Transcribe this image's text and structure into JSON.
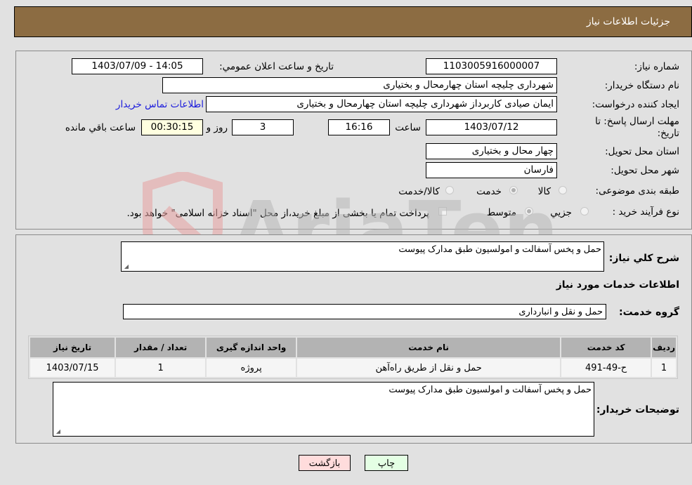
{
  "header": {
    "title": "جزئیات اطلاعات نیاز"
  },
  "fields": {
    "need_number_label": "شماره نیاز:",
    "need_number": "1103005916000007",
    "announce_label": "تاریخ و ساعت اعلان عمومي:",
    "announce_value": "1403/07/09 - 14:05",
    "buyer_org_label": "نام دستگاه خریدار:",
    "buyer_org": "شهرداری چلیچه استان چهارمحال و بختیاری",
    "creator_label": "ایجاد کننده درخواست:",
    "creator": "ایمان صیادی کاربرداز شهرداری چلیچه استان چهارمحال و بختیاری",
    "contact_link": "اطلاعات تماس خریدار",
    "deadline_label": "مهلت ارسال پاسخ: تا تاریخ:",
    "deadline_date": "1403/07/12",
    "time_label": "ساعت",
    "deadline_time": "16:16",
    "days_value": "3",
    "days_label": "روز و",
    "remaining_time": "00:30:15",
    "remaining_label": "ساعت باقي مانده",
    "province_label": "استان محل تحویل:",
    "province": "چهار محال و بختیاری",
    "city_label": "شهر محل تحویل:",
    "city": "فارسان",
    "category_label": "طبقه بندی موضوعی:",
    "category_options": [
      "کالا",
      "خدمت",
      "کالا/خدمت"
    ],
    "category_selected": "خدمت",
    "process_label": "نوع فرآیند خرید :",
    "process_options": [
      "جزیي",
      "متوسط"
    ],
    "process_selected": "متوسط",
    "treasury_note": "پرداخت تمام یا بخشی از مبلغ خرید،از محل \"اسناد خزانه اسلامی\" خواهد بود."
  },
  "details": {
    "summary_label": "شرح کلي نیاز:",
    "summary": "حمل و پخس آسفالت و امولسیون طبق مدارک پیوست",
    "services_heading": "اطلاعات خدمات مورد نیاز",
    "service_group_label": "گروه خدمت:",
    "service_group": "حمل و نقل و انبارداری",
    "table": {
      "headers": [
        "ردیف",
        "کد خدمت",
        "نام خدمت",
        "واحد اندازه گیری",
        "تعداد / مقدار",
        "تاریخ نیاز"
      ],
      "rows": [
        [
          "1",
          "ح-49-491",
          "حمل و نقل از طریق راه‌آهن",
          "پروژه",
          "1",
          "1403/07/15"
        ]
      ]
    },
    "buyer_notes_label": "توضیحات خریدار:",
    "buyer_notes": "حمل و پخس آسفالت و امولسیون طبق مدارک پیوست"
  },
  "buttons": {
    "print": "چاپ",
    "back": "بازگشت"
  },
  "watermark": {
    "text": "AriaTender.neT"
  }
}
